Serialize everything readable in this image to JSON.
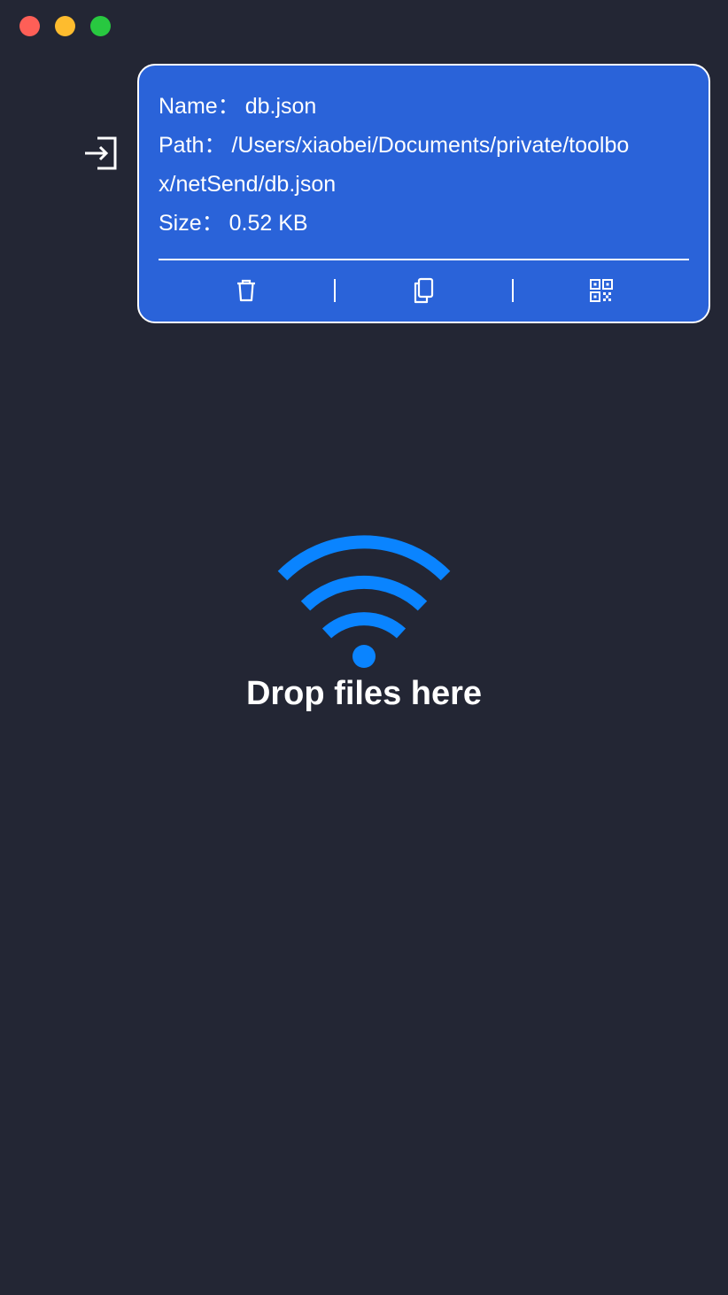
{
  "file": {
    "name_label": "Name：",
    "name_value": "db.json",
    "path_label": "Path：",
    "path_value_line1": "/Users/xiaobei/Documents/private/toolbo",
    "path_value_line2": "x/netSend/db.json",
    "size_label": "Size：",
    "size_value": "0.52 KB"
  },
  "actions": [
    {
      "icon": "trash-icon"
    },
    {
      "icon": "copy-icon"
    },
    {
      "icon": "qrcode-icon"
    }
  ],
  "drop_zone": {
    "text": "Drop files here",
    "icon": "wifi-icon"
  },
  "colors": {
    "background": "#232634",
    "card": "#2a63d9",
    "accent": "#0a84ff",
    "close": "#fe5f57",
    "minimize": "#febc2e",
    "zoom": "#28c840"
  }
}
